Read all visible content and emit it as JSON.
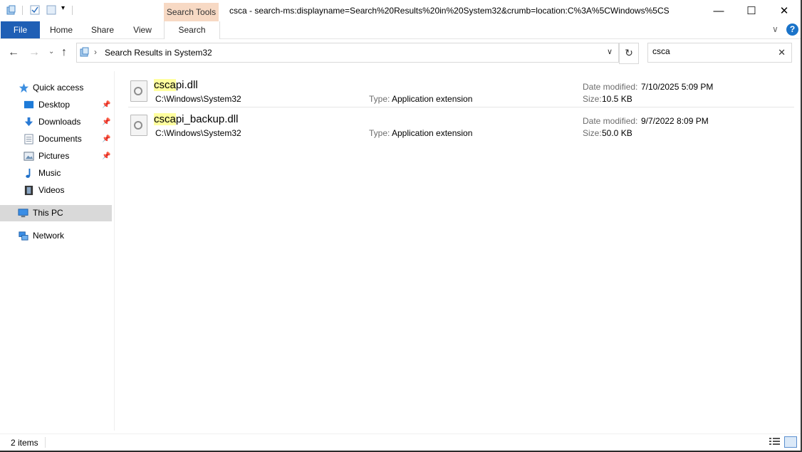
{
  "window": {
    "title": "csca - search-ms:displayname=Search%20Results%20in%20System32&crumb=location:C%3A%5CWindows%5CS",
    "contextual_tab_header": "Search Tools",
    "controls": {
      "minimize": "—",
      "maximize": "☐",
      "close": "✕"
    }
  },
  "ribbon": {
    "tabs": [
      {
        "label": "File"
      },
      {
        "label": "Home"
      },
      {
        "label": "Share"
      },
      {
        "label": "View"
      },
      {
        "label": "Search"
      }
    ],
    "help": "?"
  },
  "address": {
    "breadcrumb_text": "Search Results in System32",
    "breadcrumb_sep": "›"
  },
  "search": {
    "value": "csca"
  },
  "nav_pane": {
    "items": [
      {
        "label": "Quick access",
        "icon": "star-icon"
      },
      {
        "label": "Desktop",
        "icon": "desktop-icon",
        "pinned": true
      },
      {
        "label": "Downloads",
        "icon": "download-arrow-icon",
        "pinned": true
      },
      {
        "label": "Documents",
        "icon": "document-icon",
        "pinned": true
      },
      {
        "label": "Pictures",
        "icon": "picture-icon",
        "pinned": true
      },
      {
        "label": "Music",
        "icon": "music-note-icon"
      },
      {
        "label": "Videos",
        "icon": "film-icon"
      },
      {
        "label": "This PC",
        "icon": "computer-icon",
        "selected": true
      },
      {
        "label": "Network",
        "icon": "network-icon"
      }
    ]
  },
  "files": [
    {
      "name_match": "csca",
      "name_rest": "pi.dll",
      "path": "C:\\Windows\\System32",
      "type_label": "Type:",
      "type": "Application extension",
      "date_label": "Date modified:",
      "date": "7/10/2025 5:09 PM",
      "size_label": "Size:",
      "size": "10.5 KB"
    },
    {
      "name_match": "csca",
      "name_rest": "pi_backup.dll",
      "path": "C:\\Windows\\System32",
      "type_label": "Type:",
      "type": "Application extension",
      "date_label": "Date modified:",
      "date": "9/7/2022 8:09 PM",
      "size_label": "Size:",
      "size": "50.0 KB"
    }
  ],
  "status": {
    "item_count": "2 items"
  },
  "colors": {
    "file_tab": "#1f5fb5",
    "contextual_tab": "#f7d9c4",
    "selection": "#d9d9d9",
    "highlight": "#ffff9e"
  }
}
